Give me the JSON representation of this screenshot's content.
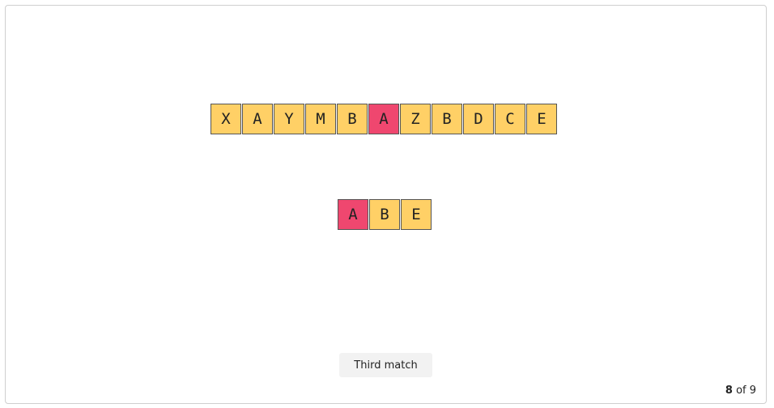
{
  "text_cells": [
    {
      "char": "X",
      "color": "#ffd066"
    },
    {
      "char": "A",
      "color": "#ffd066"
    },
    {
      "char": "Y",
      "color": "#ffd066"
    },
    {
      "char": "M",
      "color": "#ffd066"
    },
    {
      "char": "B",
      "color": "#ffd066"
    },
    {
      "char": "A",
      "color": "#ef476f"
    },
    {
      "char": "Z",
      "color": "#ffd066"
    },
    {
      "char": "B",
      "color": "#ffd066"
    },
    {
      "char": "D",
      "color": "#ffd066"
    },
    {
      "char": "C",
      "color": "#ffd066"
    },
    {
      "char": "E",
      "color": "#ffd066"
    }
  ],
  "pattern_cells": [
    {
      "char": "A",
      "color": "#ef476f"
    },
    {
      "char": "B",
      "color": "#ffd066"
    },
    {
      "char": "E",
      "color": "#ffd066"
    }
  ],
  "step_button": {
    "label": "Third match"
  },
  "pager": {
    "current": "8",
    "suffix": "of 9"
  }
}
